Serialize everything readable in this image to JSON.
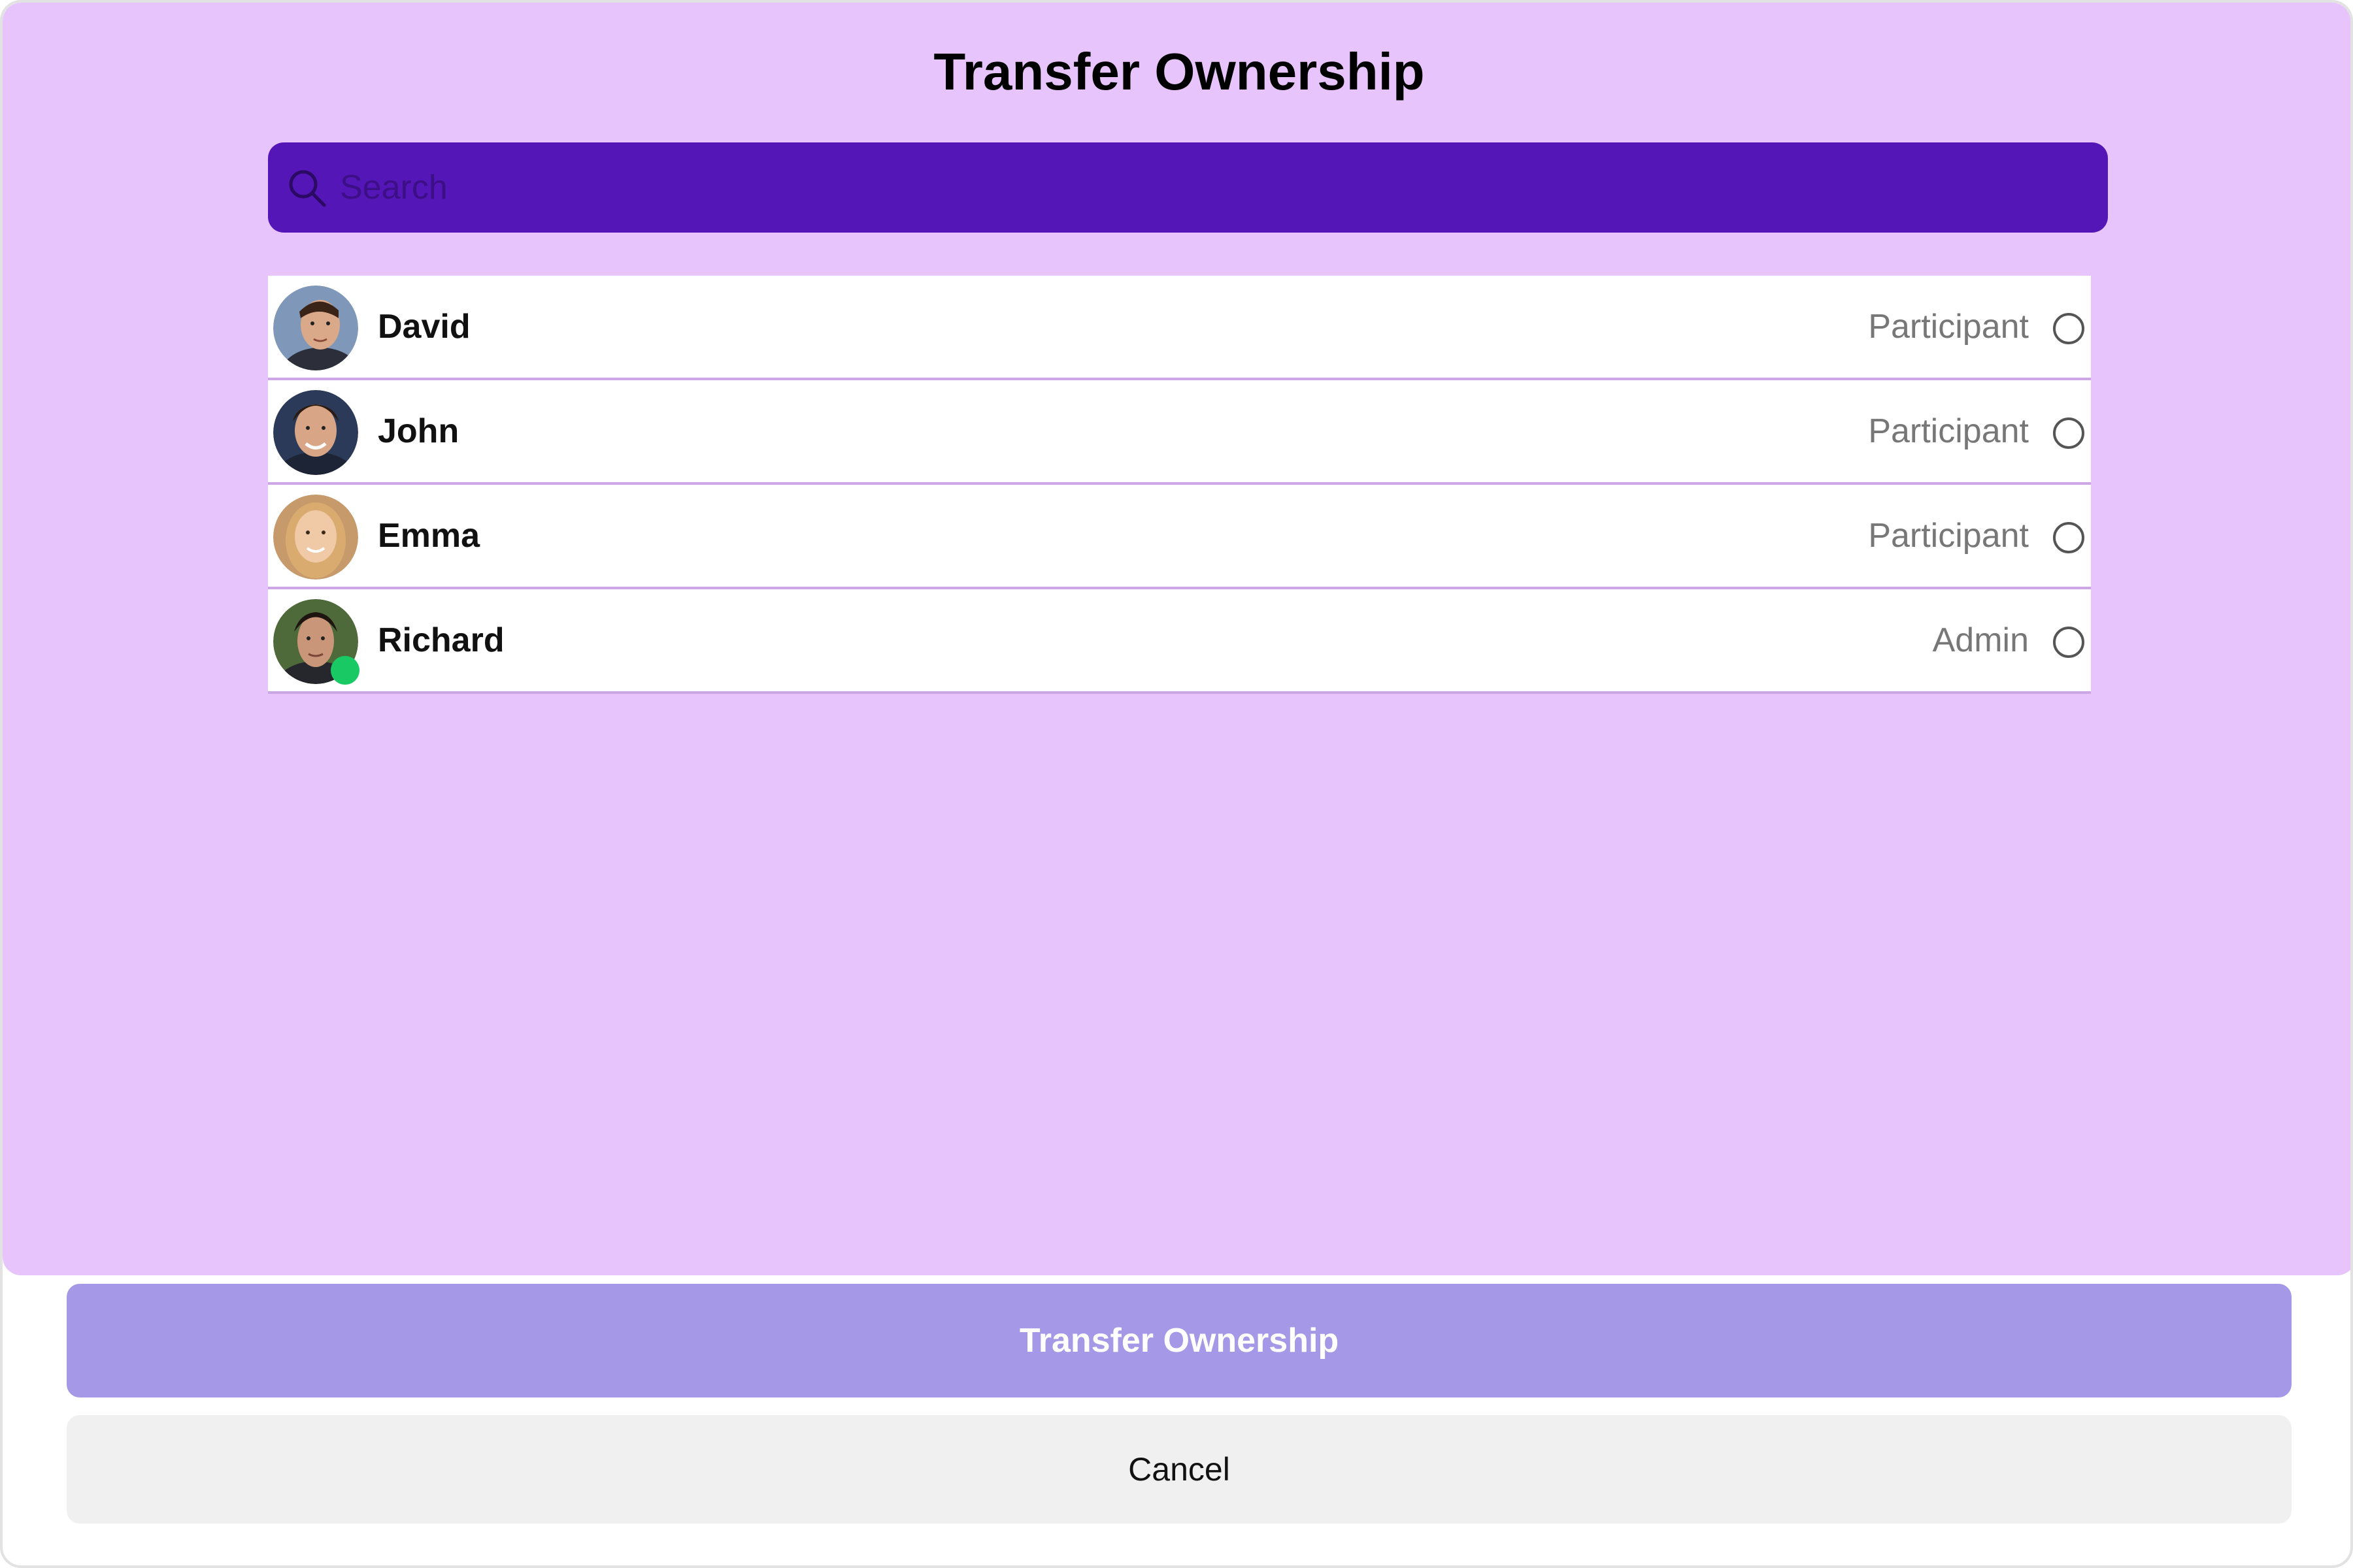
{
  "dialog": {
    "title": "Transfer Ownership",
    "search_placeholder": "Search"
  },
  "members": [
    {
      "name": "David",
      "role": "Participant",
      "online": false,
      "selected": false
    },
    {
      "name": "John",
      "role": "Participant",
      "online": false,
      "selected": false
    },
    {
      "name": "Emma",
      "role": "Participant",
      "online": false,
      "selected": false
    },
    {
      "name": "Richard",
      "role": "Admin",
      "online": true,
      "selected": false
    }
  ],
  "actions": {
    "transfer_label": "Transfer Ownership",
    "cancel_label": "Cancel"
  },
  "colors": {
    "panel_bg": "#e8c4fc",
    "search_bg": "#5516b7",
    "primary_button": "#a598e6",
    "online_indicator": "#18c964"
  }
}
